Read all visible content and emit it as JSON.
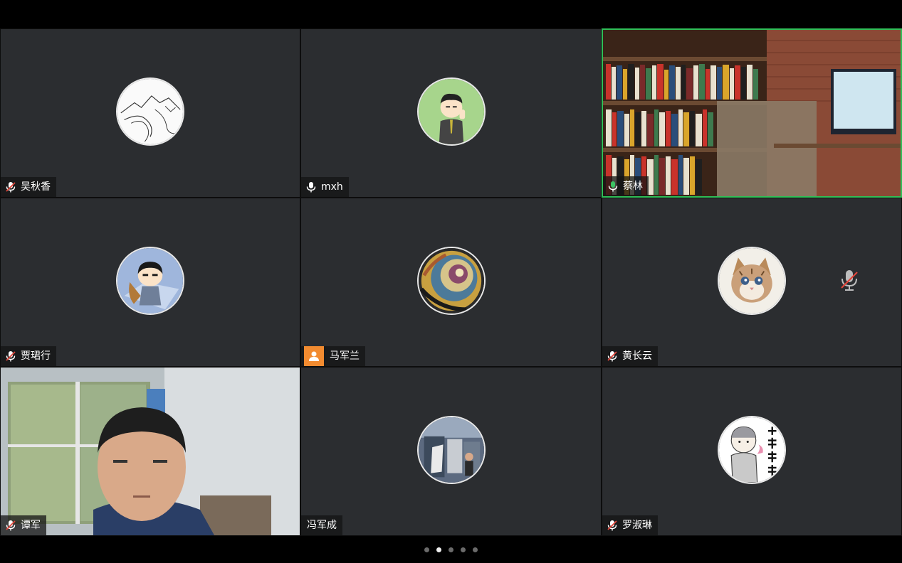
{
  "participants": [
    {
      "name": "吴秋香",
      "mic": "muted",
      "avatar": "mountain-sketch-avatar"
    },
    {
      "name": "mxh",
      "mic": "on",
      "avatar": "cartoon-man-avatar"
    },
    {
      "name": "蔡林",
      "mic": "speaking",
      "avatar": "bookshelf-video",
      "active": true
    },
    {
      "name": "贾珺行",
      "mic": "muted",
      "avatar": "cartoon-boy-avatar"
    },
    {
      "name": "马军兰",
      "mic": "none",
      "avatar": "spiral-shell-avatar",
      "label_icon": "person-icon"
    },
    {
      "name": "黄长云",
      "mic": "muted",
      "avatar": "kitten-avatar",
      "extra_icon": "muted-mic-icon"
    },
    {
      "name": "谭军",
      "mic": "muted",
      "avatar": "live-camera-video"
    },
    {
      "name": "冯军成",
      "mic": "none",
      "avatar": "street-photo-avatar"
    },
    {
      "name": "罗淑琳",
      "mic": "muted",
      "avatar": "monk-cartoon-avatar"
    }
  ],
  "pager": {
    "pages": 5,
    "current": 2
  },
  "colors": {
    "active_border": "#2fbf58",
    "tile_bg": "#2b2d30",
    "muted_red": "#e0453a",
    "speaking_green": "#3cc364",
    "person_badge": "#f28b30"
  }
}
